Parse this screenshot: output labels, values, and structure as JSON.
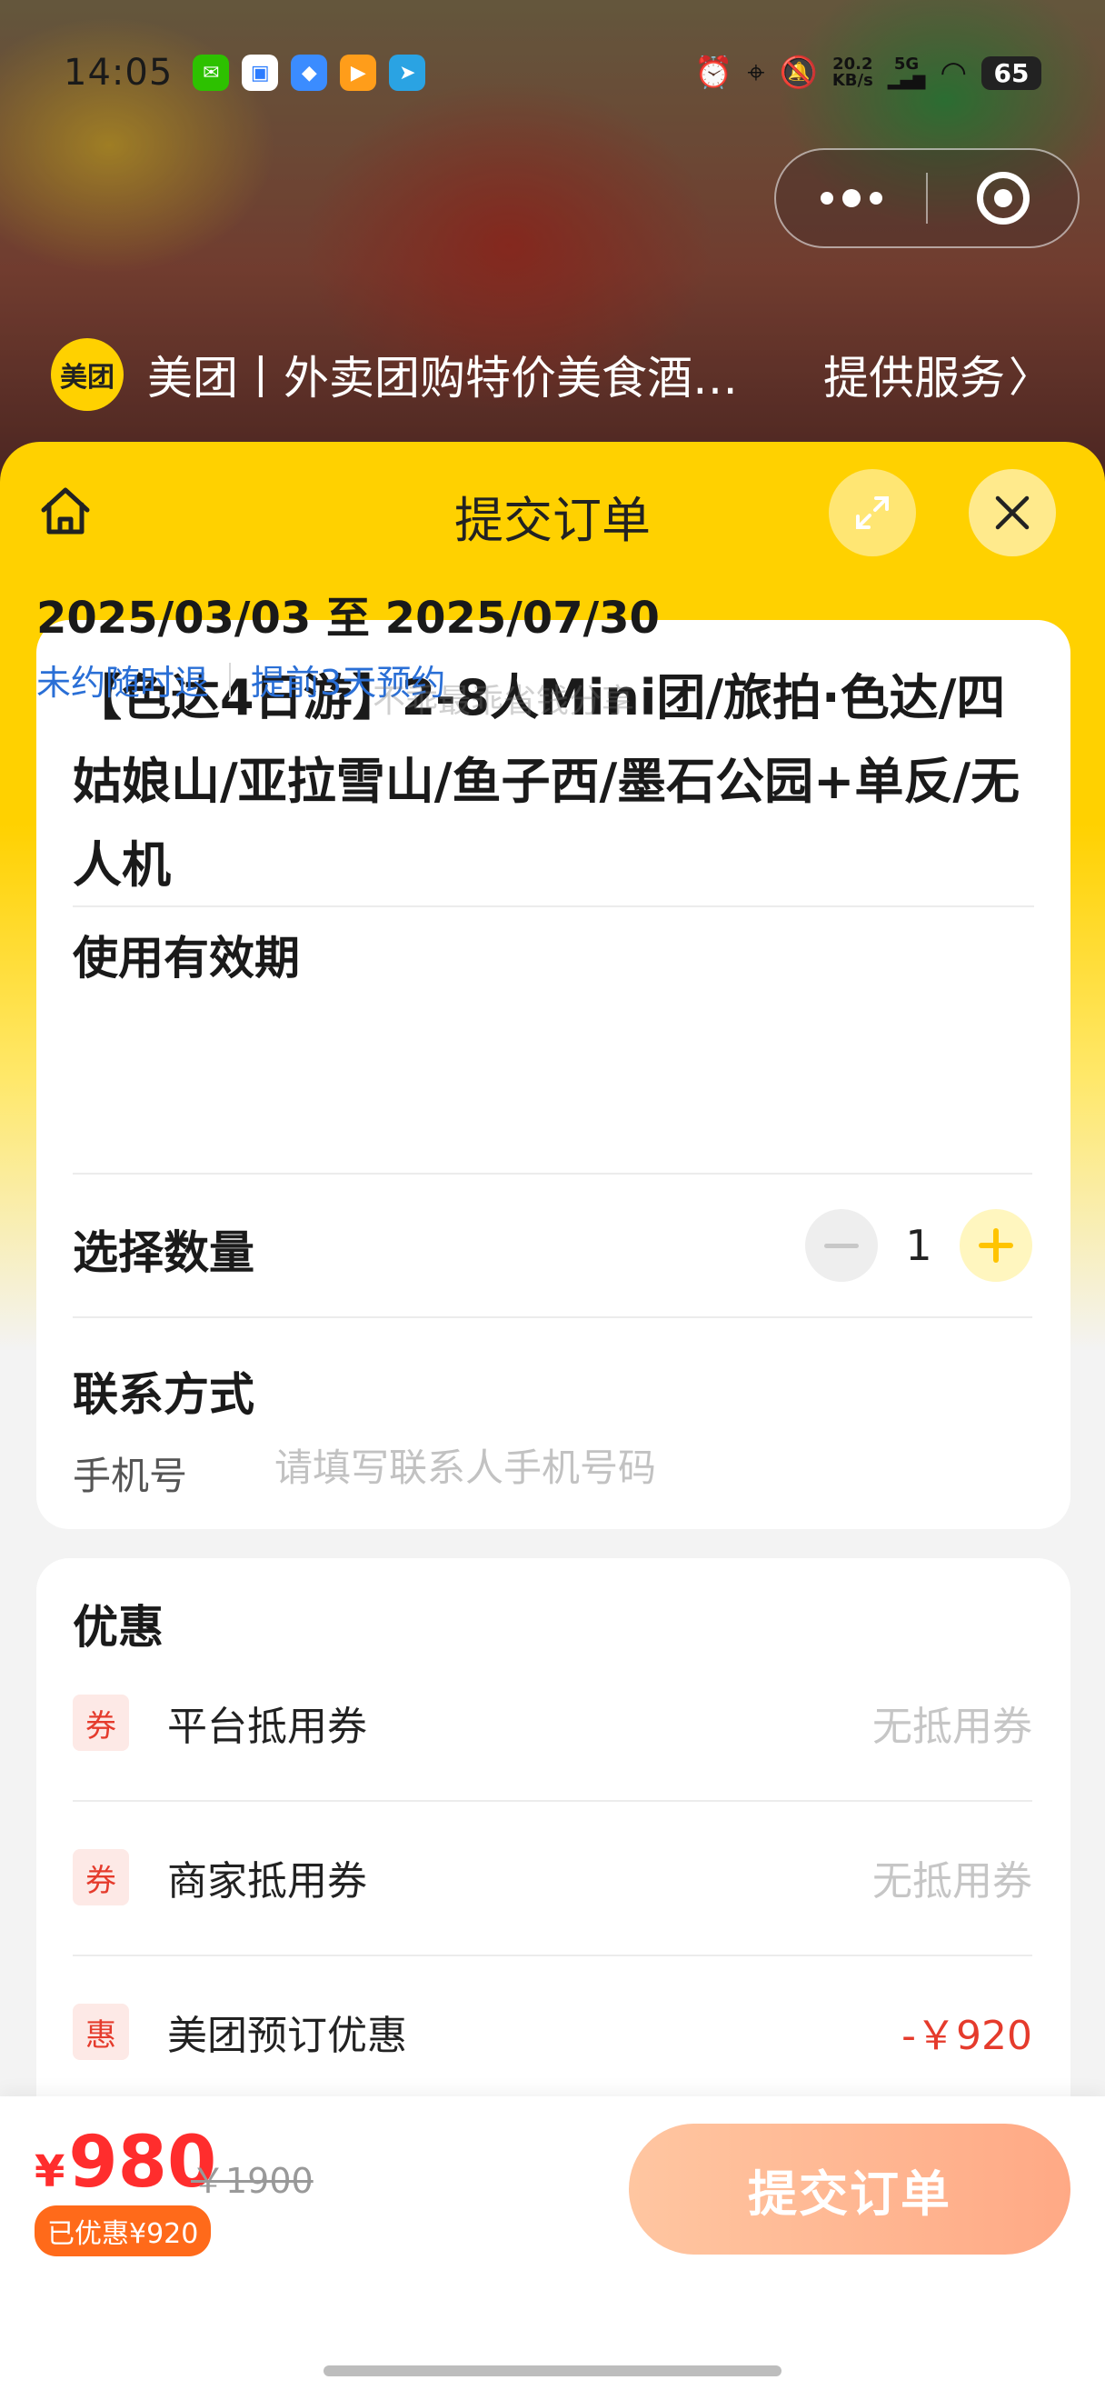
{
  "status_bar": {
    "time": "14:05",
    "net_speed_value": "20.2",
    "net_speed_unit": "KB/s",
    "network": "5G",
    "battery": "65",
    "apps": [
      {
        "name": "wechat-icon",
        "glyph": "✉",
        "color": "#2dc100"
      },
      {
        "name": "message-app-icon",
        "glyph": "▣",
        "color": "#ffffff"
      },
      {
        "name": "files-app-icon",
        "glyph": "◆",
        "color": "#3b8cff"
      },
      {
        "name": "video-app-icon",
        "glyph": "▶",
        "color": "#ff9d1a"
      },
      {
        "name": "telegram-icon",
        "glyph": "➤",
        "color": "#2aa3e3"
      }
    ]
  },
  "service": {
    "logo_text": "美团",
    "name": "美团丨外卖团购特价美食酒…",
    "link_label": "提供服务",
    "chevron": "〉"
  },
  "sheet": {
    "title": "提交订单"
  },
  "product": {
    "title": "【色达4日游】2-8人Mini团/旅拍·色达/四姑娘山/亚拉雪山/鱼子西/墨石公园+单反/无人机",
    "validity_label": "使用有效期",
    "validity_range": "2025/03/03 至 2025/07/30",
    "tag_refund": "未约随时退",
    "tag_booking": "提前3天预约",
    "watermark": "不乖最乖省钱分享",
    "quantity_label": "选择数量",
    "quantity": "1",
    "contact_label": "联系方式",
    "phone_label": "手机号",
    "phone_placeholder": "请填写联系人手机号码",
    "phone_value": ""
  },
  "discounts": {
    "title": "优惠",
    "rows": [
      {
        "badge": "券",
        "name": "平台抵用券",
        "value": "无抵用券"
      },
      {
        "badge": "券",
        "name": "商家抵用券",
        "value": "无抵用券"
      },
      {
        "badge": "惠",
        "name": "美团预订优惠",
        "value": "-￥920"
      }
    ]
  },
  "bottom": {
    "currency": "¥",
    "price": "980",
    "original_price": "￥1900",
    "saved": "已优惠¥920",
    "submit_label": "提交订单"
  },
  "colors": {
    "brand_yellow": "#ffd100",
    "price_red": "#ff2d2d",
    "link_blue": "#2a6fd6",
    "submit_gradient_start": "#ffc6a1",
    "submit_gradient_end": "#ffa985"
  }
}
